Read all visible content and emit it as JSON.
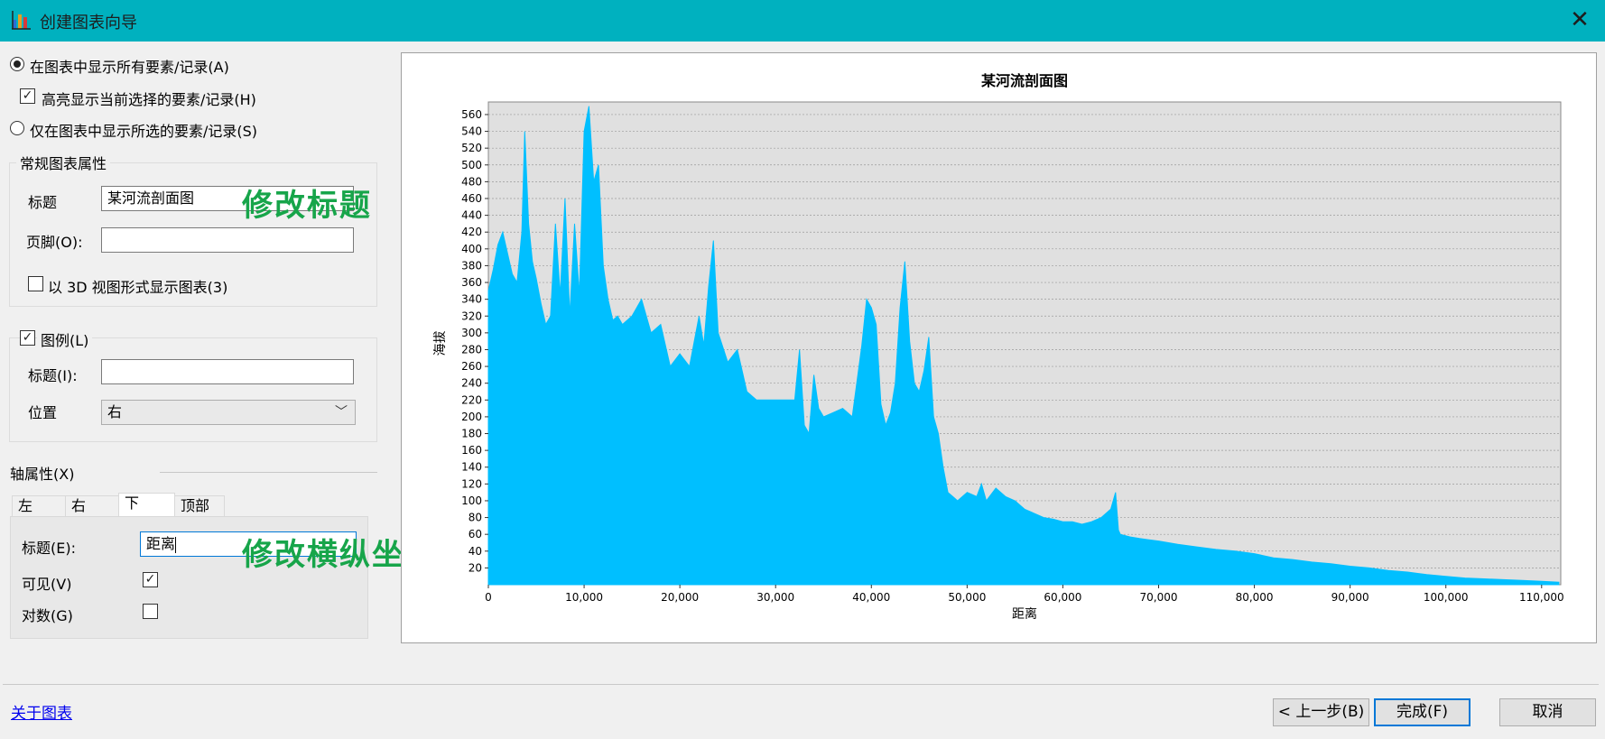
{
  "window": {
    "title": "创建图表向导",
    "close_glyph": "✕"
  },
  "display": {
    "show_all": "在图表中显示所有要素/记录(A)",
    "highlight": "高亮显示当前选择的要素/记录(H)",
    "show_selected": "仅在图表中显示所选的要素/记录(S)"
  },
  "general": {
    "group_title": "常规图表属性",
    "title_label": "标题",
    "title_value": "某河流剖面图",
    "footer_label": "页脚(O):",
    "footer_value": "",
    "view3d_label": "以 3D 视图形式显示图表(3)"
  },
  "legend": {
    "label": "图例(L)",
    "title_label": "标题(I):",
    "title_value": "",
    "position_label": "位置",
    "position_value": "右"
  },
  "axis": {
    "group_title": "轴属性(X)",
    "tabs": [
      "左",
      "右",
      "下",
      "顶部"
    ],
    "active_tab": "下",
    "title_label": "标题(E):",
    "title_value": "距离",
    "visible_label": "可见(V)",
    "log_label": "对数(G)"
  },
  "annotations": {
    "edit_title": "修改标题",
    "edit_axes": "修改横纵坐标"
  },
  "footer": {
    "about_link": "关于图表",
    "back": "< 上一步(B)",
    "finish": "完成(F)",
    "cancel": "取消"
  },
  "colors": {
    "titlebar": "#00b1bf",
    "area": "#00bfff",
    "plot_bg": "#e0e0e0",
    "annotation": "#17a54a"
  },
  "chart_data": {
    "type": "area",
    "title": "某河流剖面图",
    "xlabel": "距离",
    "ylabel": "海拔",
    "xlim": [
      0,
      112000
    ],
    "ylim": [
      0,
      575
    ],
    "xticks": [
      0,
      10000,
      20000,
      30000,
      40000,
      50000,
      60000,
      70000,
      80000,
      90000,
      100000,
      110000
    ],
    "xtick_labels": [
      "0",
      "10,000",
      "20,000",
      "30,000",
      "40,000",
      "50,000",
      "60,000",
      "70,000",
      "80,000",
      "90,000",
      "100,000",
      "110,000"
    ],
    "yticks": [
      20,
      40,
      60,
      80,
      100,
      120,
      140,
      160,
      180,
      200,
      220,
      240,
      260,
      280,
      300,
      320,
      340,
      360,
      380,
      400,
      420,
      440,
      460,
      480,
      500,
      520,
      540,
      560
    ],
    "grid": true,
    "legend": "none",
    "x": [
      0,
      500,
      1000,
      1500,
      2000,
      2500,
      3000,
      3500,
      3800,
      4200,
      4600,
      5000,
      5500,
      6000,
      6500,
      7000,
      7500,
      8000,
      8500,
      9000,
      9500,
      10000,
      10500,
      11000,
      11500,
      12000,
      12500,
      13000,
      13500,
      14000,
      15000,
      16000,
      17000,
      18000,
      19000,
      20000,
      21000,
      22000,
      22500,
      23000,
      23500,
      24000,
      25000,
      26000,
      27000,
      28000,
      29000,
      30000,
      31000,
      32000,
      32500,
      33000,
      33500,
      34000,
      34500,
      35000,
      36000,
      37000,
      38000,
      39000,
      39500,
      40000,
      40500,
      41000,
      41500,
      42000,
      42500,
      43000,
      43500,
      44000,
      44500,
      45000,
      45500,
      46000,
      46500,
      47000,
      47500,
      48000,
      48500,
      49000,
      50000,
      51000,
      51500,
      52000,
      53000,
      54000,
      55000,
      56000,
      57000,
      58000,
      59000,
      60000,
      61000,
      62000,
      63000,
      64000,
      65000,
      65500,
      65800,
      66000,
      67000,
      68000,
      70000,
      72000,
      74000,
      76000,
      78000,
      80000,
      82000,
      84000,
      86000,
      88000,
      90000,
      92000,
      94000,
      96000,
      98000,
      100000,
      102000,
      104000,
      106000,
      108000,
      110000,
      111800
    ],
    "y": [
      350,
      375,
      405,
      420,
      395,
      370,
      360,
      420,
      540,
      430,
      385,
      365,
      335,
      310,
      320,
      430,
      345,
      460,
      320,
      430,
      345,
      540,
      570,
      480,
      500,
      380,
      340,
      315,
      320,
      310,
      320,
      340,
      300,
      310,
      260,
      275,
      260,
      320,
      285,
      355,
      410,
      300,
      265,
      280,
      230,
      220,
      220,
      220,
      220,
      220,
      280,
      190,
      180,
      250,
      210,
      200,
      205,
      210,
      200,
      285,
      340,
      330,
      310,
      215,
      190,
      205,
      240,
      330,
      385,
      290,
      240,
      230,
      255,
      295,
      200,
      180,
      140,
      110,
      105,
      100,
      110,
      105,
      120,
      100,
      115,
      105,
      100,
      90,
      85,
      80,
      78,
      75,
      75,
      72,
      75,
      80,
      90,
      110,
      65,
      60,
      57,
      55,
      52,
      48,
      45,
      42,
      40,
      37,
      32,
      30,
      27,
      25,
      22,
      20,
      17,
      15,
      12,
      10,
      8,
      7,
      6,
      5,
      4,
      3
    ]
  }
}
